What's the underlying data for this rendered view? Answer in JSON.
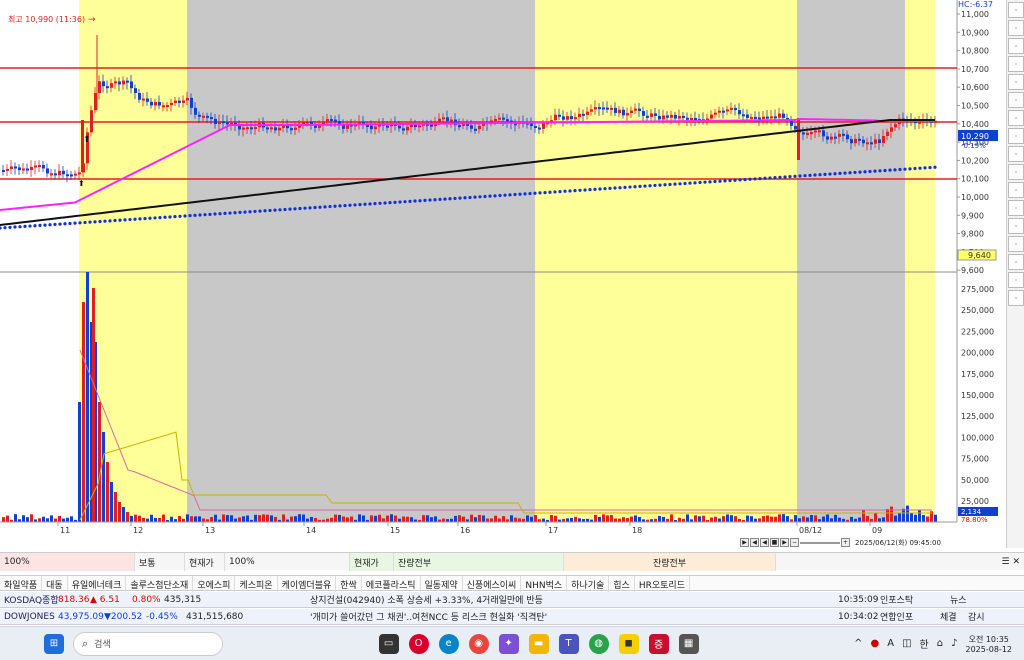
{
  "chart": {
    "high_label": "최고 10,990 (11:36)",
    "hc_label": "HC:-6.37",
    "price_ticks": [
      "11,000",
      "10,900",
      "10,800",
      "10,700",
      "10,600",
      "10,500",
      "10,400",
      "10,300",
      "10,200",
      "10,100",
      "10,000",
      "9,900",
      "9,800",
      "9,700",
      "9,600"
    ],
    "current_price": "10,290",
    "current_change": "-0.19%",
    "low_marker": "9,640",
    "volume_ticks": [
      "275,000",
      "250,000",
      "225,000",
      "200,000",
      "175,000",
      "150,000",
      "125,000",
      "100,000",
      "75,000",
      "50,000",
      "25,000"
    ],
    "volume_current": "2,134",
    "volume_pct": "78.80%",
    "date_labels": [
      "11",
      "12",
      "13",
      "14",
      "15",
      "16",
      "17",
      "18",
      "08/12",
      "09"
    ],
    "datetime_box": "2025/06/12(화) 09:45:00",
    "colors": {
      "up": "#e02020",
      "down": "#1040d0",
      "ma_magenta": "#ff20ff",
      "ma_black": "#111111",
      "ma_blue": "#1030d0",
      "yellow": "#ffff99",
      "gray": "#c8c8c8"
    }
  },
  "toolbar_right": [
    "font-icon",
    "crosshair-icon",
    "cursor-icon",
    "line-icon",
    "trend-icon",
    "fib-icon",
    "ruler-icon",
    "auto-icon",
    "wave-icon",
    "shape-icon",
    "arrow-icon",
    "text-icon",
    "box-icon",
    "eraser-icon",
    "pen-icon",
    "all-icon",
    "text2-icon"
  ],
  "status_row": {
    "left_pct": "100%",
    "mode": "보통",
    "price_type": "현재가",
    "pct": "100%",
    "current": "현재가",
    "balance": "잔량전부",
    "balance2": "잔량전부"
  },
  "tags": [
    "화일약품",
    "대동",
    "유일에너테크",
    "솔루스첨단소재",
    "오에스피",
    "케스피온",
    "케이엠더블유",
    "한싹",
    "에코플라스틱",
    "일동제약",
    "신풍에스이씨",
    "NHN벅스",
    "하나기술",
    "힙스",
    "HR오토리드"
  ],
  "ticker1": {
    "index_name": "KOSDAQ종합",
    "index_value": "818.36",
    "change": "▲ 6.51",
    "pct": "0.80%",
    "volume": "435,315",
    "news": "상지건설(042940) 소폭 상승세 +3.33%, 4거래일만에 반등",
    "time": "10:35:09",
    "source": "인포스탁",
    "tab": "뉴스"
  },
  "ticker2": {
    "index_name": "DOWJONES",
    "index_value": "43,975.09",
    "change": "▼200.52",
    "pct": "-0.45%",
    "volume": "431,515,680",
    "news": "'개미가 쓸어갔던 그 채권'..여천NCC 등 리스크 현실화 '직격탄'",
    "time": "10:34:02",
    "source": "연합인포",
    "tab1": "체결",
    "tab2": "감시"
  },
  "taskbar": {
    "search_placeholder": "검색",
    "time": "오전 10:35",
    "date": "2025-08-12",
    "lang": "한",
    "font_a": "A"
  }
}
